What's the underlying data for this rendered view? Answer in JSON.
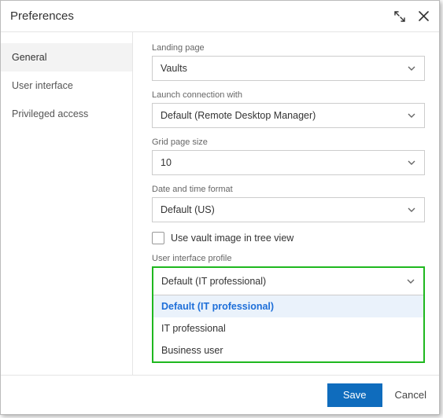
{
  "header": {
    "title": "Preferences"
  },
  "sidebar": {
    "items": [
      {
        "label": "General",
        "active": true
      },
      {
        "label": "User interface",
        "active": false
      },
      {
        "label": "Privileged access",
        "active": false
      }
    ]
  },
  "form": {
    "landing_page": {
      "label": "Landing page",
      "value": "Vaults"
    },
    "launch_with": {
      "label": "Launch connection with",
      "value": "Default (Remote Desktop Manager)"
    },
    "grid_page_size": {
      "label": "Grid page size",
      "value": "10"
    },
    "date_format": {
      "label": "Date and time format",
      "value": "Default (US)"
    },
    "vault_image": {
      "label": "Use vault image in tree view",
      "checked": false
    },
    "ui_profile": {
      "label": "User interface profile",
      "value": "Default (IT professional)",
      "options": [
        "Default (IT professional)",
        "IT professional",
        "Business user"
      ],
      "selected_index": 0
    }
  },
  "footer": {
    "save": "Save",
    "cancel": "Cancel"
  }
}
